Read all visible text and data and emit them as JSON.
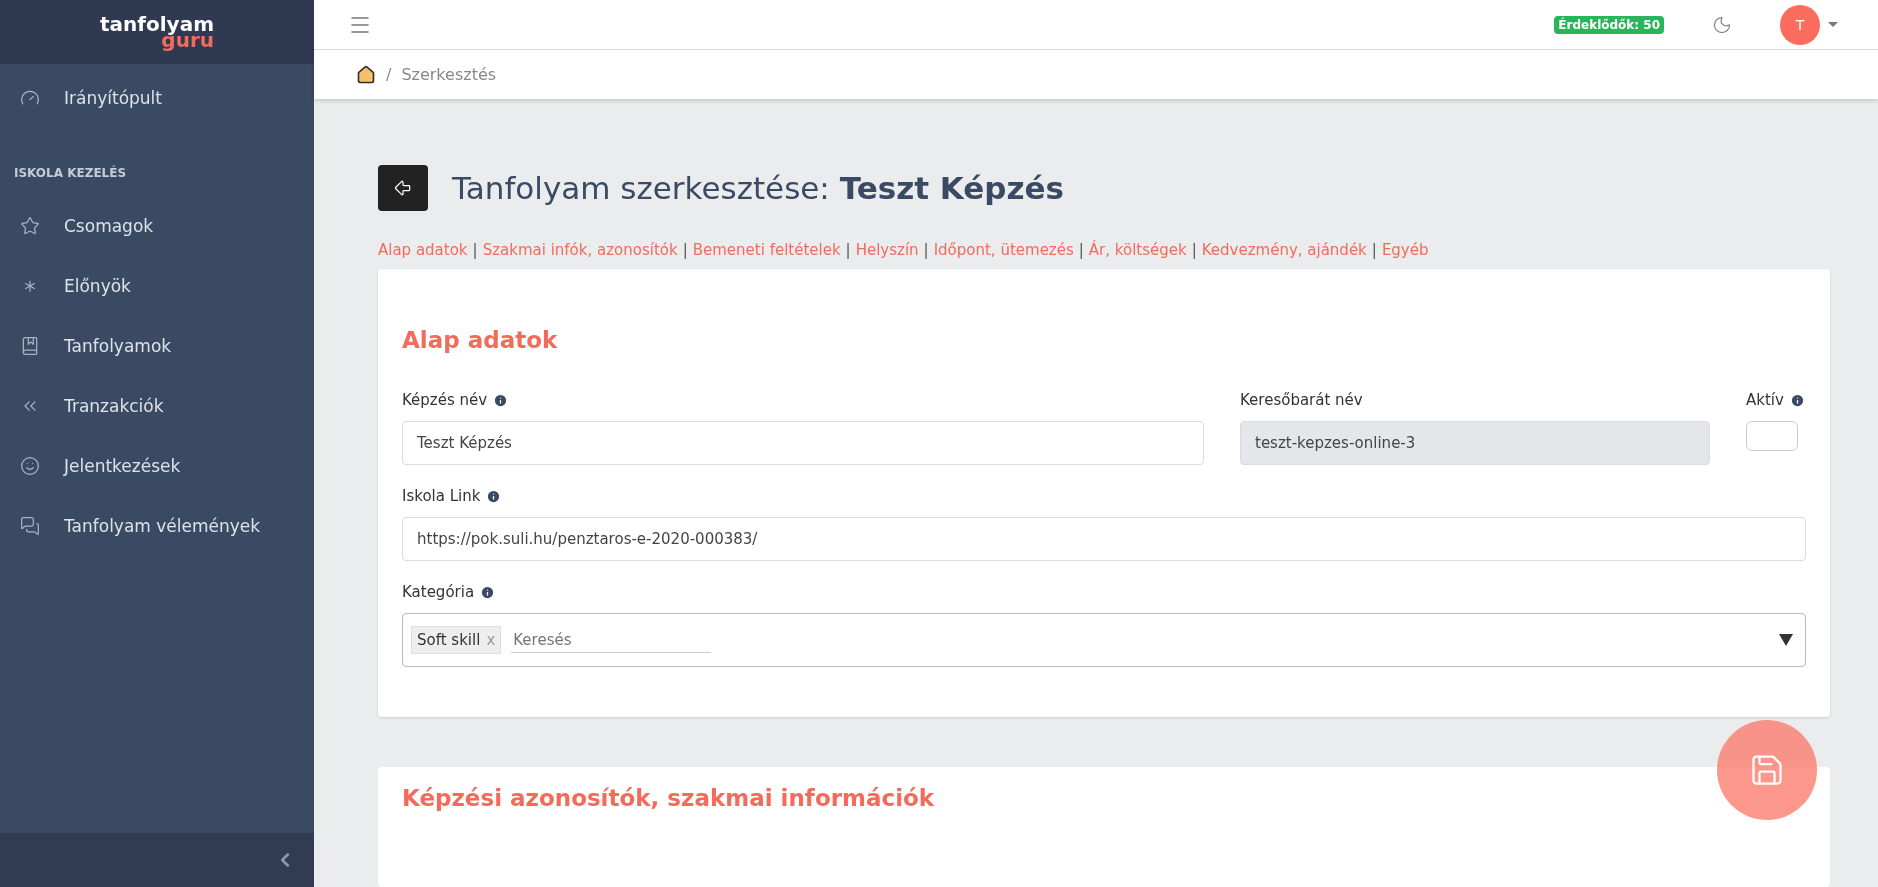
{
  "logo": {
    "line_1": "tanfolyam",
    "line_2": "guru"
  },
  "sidebar": {
    "items": [
      {
        "label": "Irányítópult",
        "selected": false
      }
    ],
    "section_title": "ISKOLA KEZELÉS",
    "section_items": [
      {
        "label": "Csomagok",
        "selected": false
      },
      {
        "label": "Előnyök",
        "selected": false
      },
      {
        "label": "Tanfolyamok",
        "selected": false
      },
      {
        "label": "Tranzakciók",
        "selected": false
      },
      {
        "label": "Jelentkezések",
        "selected": false
      },
      {
        "label": "Tanfolyam vélemények",
        "selected": false
      }
    ]
  },
  "topbar": {
    "badge": "Érdeklődők: 50",
    "avatar": "T"
  },
  "breadcrumb": {
    "separator": "/",
    "current": "Szerkesztés"
  },
  "page_title": {
    "prefix": "Tanfolyam szerkesztése:",
    "name": "Teszt Képzés"
  },
  "link_separator": "|",
  "section_links": [
    "Alap adatok",
    "Szakmai infók, azonosítók",
    "Bemeneti feltételek",
    "Helyszín",
    "Időpont, ütemezés",
    "Ár, költségek",
    "Kedvezmény, ajándék",
    "Egyéb"
  ],
  "card": {
    "title": "Alap adatok",
    "name_field": {
      "label": "Képzés név",
      "value": "Teszt Képzés"
    },
    "slug_field": {
      "label": "Keresőbarát név",
      "value": "teszt-kepzes-online-3"
    },
    "active": {
      "label": "Aktív",
      "checked": false
    },
    "link_field": {
      "label": "Iskola Link",
      "value": "https://pok.suli.hu/penztaros-e-2020-000383/"
    },
    "category": {
      "label": "Kategória",
      "tags": [
        "Soft skill"
      ],
      "remove": "x",
      "placeholder": "Keresés"
    }
  },
  "next_card": {
    "title": "Képzési azonosítók, szakmai információk"
  }
}
